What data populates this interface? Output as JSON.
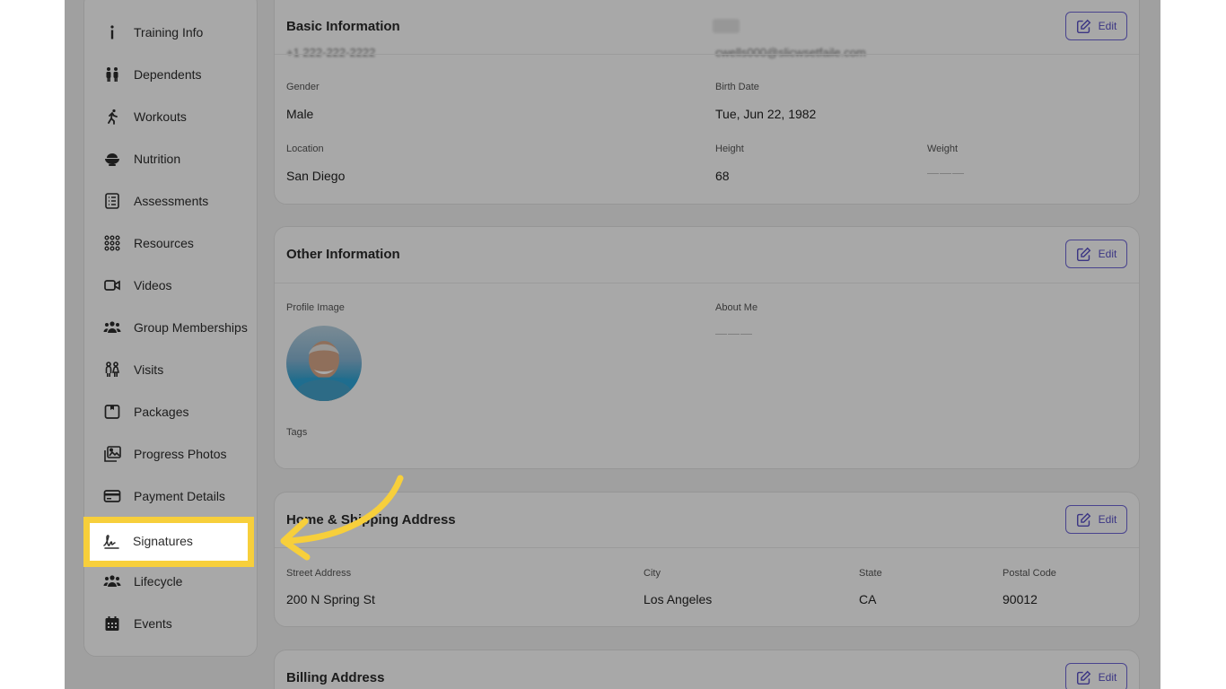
{
  "sidebar": {
    "items": [
      {
        "label": "Training Info",
        "icon": "info-icon"
      },
      {
        "label": "Dependents",
        "icon": "dependents-icon"
      },
      {
        "label": "Workouts",
        "icon": "running-person-icon"
      },
      {
        "label": "Nutrition",
        "icon": "bowl-icon"
      },
      {
        "label": "Assessments",
        "icon": "checklist-icon"
      },
      {
        "label": "Resources",
        "icon": "grid-dots-icon"
      },
      {
        "label": "Videos",
        "icon": "video-camera-icon"
      },
      {
        "label": "Group Memberships",
        "icon": "group-icon"
      },
      {
        "label": "Visits",
        "icon": "couple-icon"
      },
      {
        "label": "Packages",
        "icon": "package-icon"
      },
      {
        "label": "Progress Photos",
        "icon": "photos-icon"
      },
      {
        "label": "Payment Details",
        "icon": "credit-card-icon"
      },
      {
        "label": "Signatures",
        "icon": "signature-icon"
      },
      {
        "label": "Lifecycle",
        "icon": "lifecycle-icon"
      },
      {
        "label": "Events",
        "icon": "calendar-icon"
      }
    ]
  },
  "basic_info": {
    "title": "Basic Information",
    "edit_label": "Edit",
    "phone_partial": "+1 222-222-2222",
    "email_partial": "cwells000@slicwsetfaile.com",
    "gender_label": "Gender",
    "gender_value": "Male",
    "birth_label": "Birth Date",
    "birth_value": "Tue, Jun 22, 1982",
    "location_label": "Location",
    "location_value": "San Diego",
    "height_label": "Height",
    "height_value": "68",
    "weight_label": "Weight",
    "weight_value": "———"
  },
  "other_info": {
    "title": "Other Information",
    "edit_label": "Edit",
    "profile_image_label": "Profile Image",
    "about_label": "About Me",
    "about_value": "———",
    "tags_label": "Tags"
  },
  "home_address": {
    "title": "Home & Shipping Address",
    "edit_label": "Edit",
    "street_label": "Street Address",
    "street_value": "200 N Spring St",
    "city_label": "City",
    "city_value": "Los Angeles",
    "state_label": "State",
    "state_value": "CA",
    "postal_label": "Postal Code",
    "postal_value": "90012"
  },
  "billing_address": {
    "title": "Billing Address",
    "edit_label": "Edit"
  },
  "colors": {
    "accent": "#6f67d8",
    "highlight": "#f7cf3b",
    "overlay": "rgba(0,0,0,0.34)"
  }
}
